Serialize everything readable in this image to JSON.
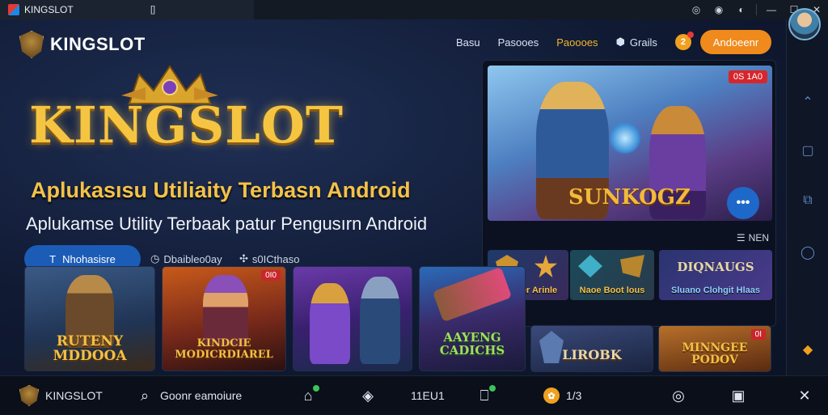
{
  "window": {
    "tab_title": "KINGSLOT",
    "tab_close": "[]",
    "controls": [
      "◎",
      "◉",
      "◐",
      "—",
      "☐",
      "✕"
    ]
  },
  "brand": {
    "name": "KINGSLOT"
  },
  "nav": {
    "links": [
      "Basu",
      "Pasooes"
    ],
    "hot_link": "Paoooes",
    "icon_link": "Grails",
    "coin_count": "2",
    "cta": "Andoeenr"
  },
  "hero": {
    "title": "KINGSLOT",
    "subtitle": "Aplukasısu Utiliaity Terbasn Android",
    "tagline": "Aplukamse Utility Terbaak patur  Pengusırn Android",
    "download_label": "Nhohasisre",
    "download_prefix": "T",
    "meta_1": "Dbaibleo0ay",
    "meta_2": "s0ICthaso"
  },
  "featured": {
    "badge": "0S 1A0",
    "game_title": "SUNKOGZ",
    "more_label": "•••",
    "menu_label": "NEN",
    "minis": [
      {
        "label": "Nooner Arinle"
      },
      {
        "label": "Naoe Boot lous"
      },
      {
        "label": "DIQNAUGS"
      },
      {
        "label": "Sluano Clohgit Hlaas"
      }
    ]
  },
  "cards": [
    {
      "label": "RUTENY MDDOOA",
      "badge": ""
    },
    {
      "label": "KINDCIE MODICRDIAREL",
      "badge": "0I0"
    },
    {
      "label": "",
      "badge": ""
    },
    {
      "label": "AAYENG CADICHS",
      "badge": ""
    },
    {
      "label": "LIROBK",
      "badge": ""
    },
    {
      "label": "MINNGEE PODOV",
      "badge": "0I"
    }
  ],
  "bottom": {
    "brand": "KINGSLOT",
    "search": "Goonr eamoiure",
    "count": "11EU1",
    "score": "1/3"
  },
  "colors": {
    "accent": "#f08a1c",
    "gold": "#f5c542",
    "primary": "#1b5cb6"
  }
}
